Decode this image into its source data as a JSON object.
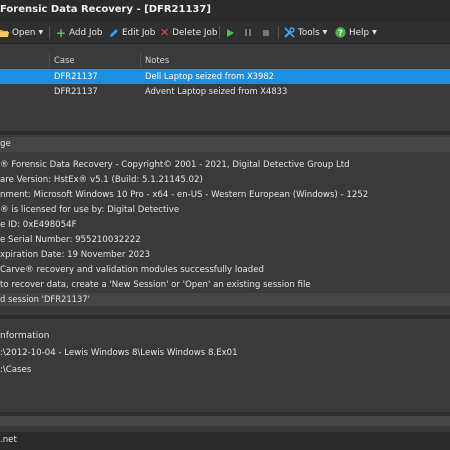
{
  "window": {
    "title": "Forensic Data Recovery - [DFR21137]"
  },
  "toolbar": {
    "open_label": "Open",
    "add_job_label": "Add Job",
    "edit_job_label": "Edit Job",
    "delete_job_label": "Delete Job",
    "tools_label": "Tools",
    "help_label": "Help"
  },
  "jobs": {
    "columns": [
      "Case",
      "Notes"
    ],
    "rows": [
      {
        "case": "DFR21137",
        "notes": "Dell Laptop seized from X3982"
      },
      {
        "case": "DFR21137",
        "notes": "Advent Laptop seized from X4833"
      }
    ]
  },
  "messages": {
    "header": "ge",
    "lines": [
      "® Forensic Data Recovery - Copyright© 2001 - 2021, Digital Detective Group Ltd",
      "are Version: HstEx® v5.1 (Build: 5.1.21145.02)",
      "nment: Microsoft Windows 10 Pro - x64 - en-US - Western European (Windows) - 1252",
      "® is licensed for use by: Digital Detective",
      "e ID: 0xE498054F",
      "e Serial Number: 955210032222",
      "xpiration Date: 19 November 2023",
      "Carve® recovery and validation modules successfully loaded",
      "to recover data, create a 'New Session' or 'Open' an existing session file"
    ],
    "status": "d session 'DFR21137'"
  },
  "info": {
    "header": "nformation",
    "lines": [
      ":\\2012-10-04 - Lewis Windows 8\\Lewis Windows 8.Ex01",
      ":\\Cases"
    ]
  },
  "footer": {
    "text": ".net"
  },
  "colors": {
    "selection": "#1c8fe0",
    "background": "#3a3a3a",
    "panel_header": "#454545"
  }
}
